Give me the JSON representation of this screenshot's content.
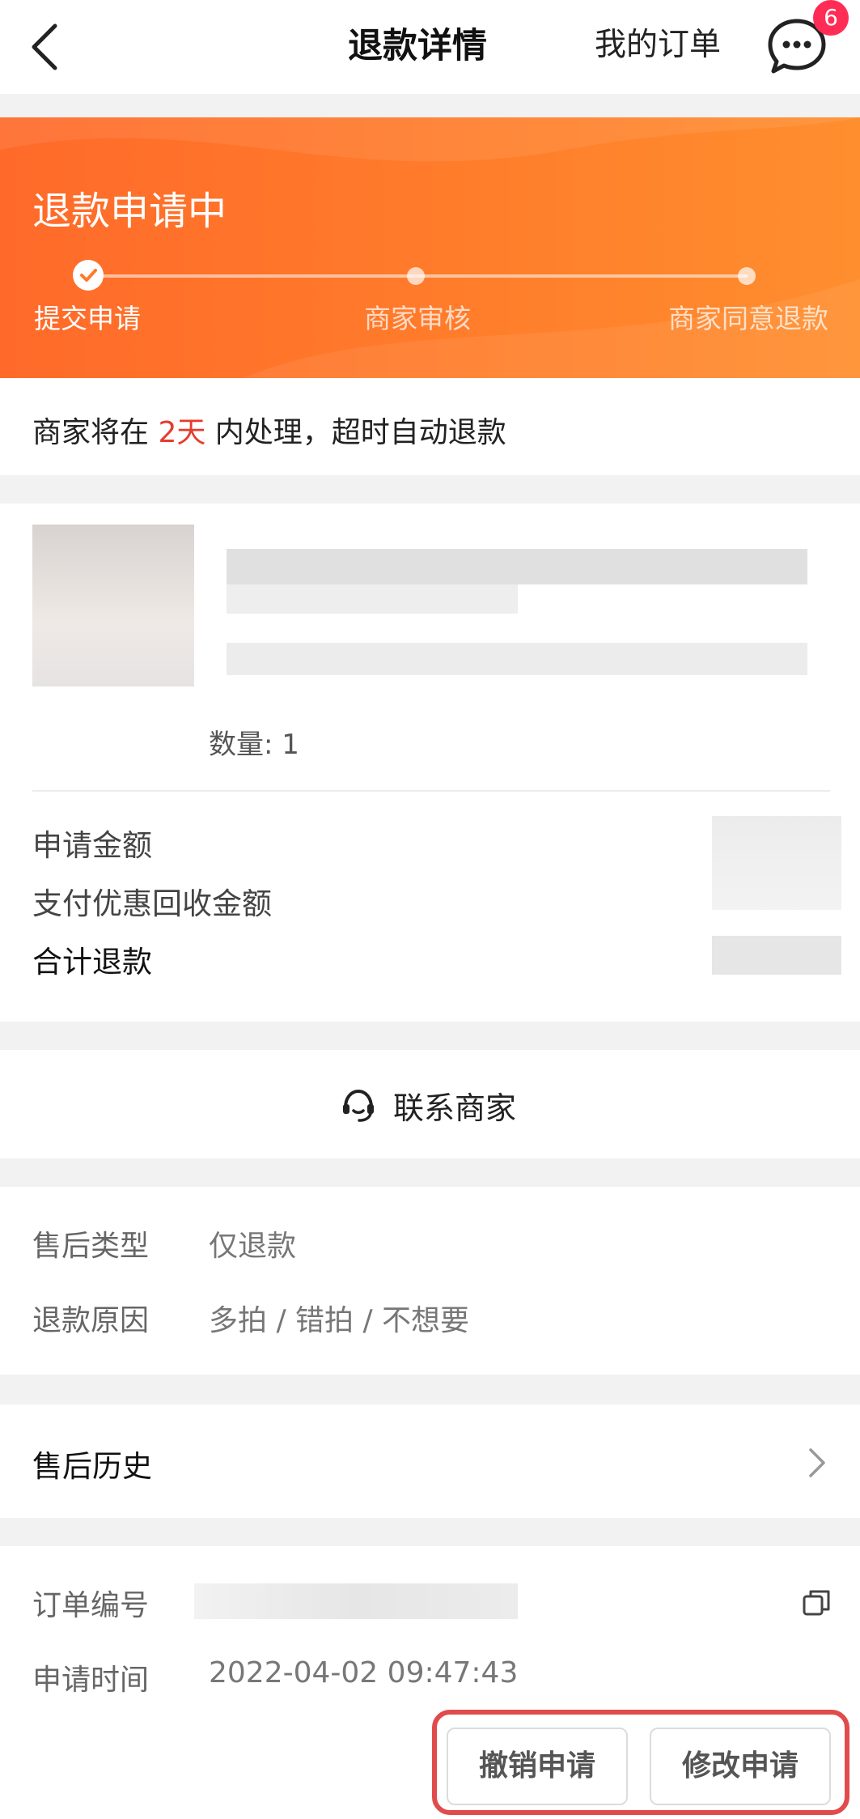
{
  "header": {
    "title": "退款详情",
    "orders_link": "我的订单",
    "message_badge": "6"
  },
  "status": {
    "title": "退款申请中",
    "steps": [
      {
        "label": "提交申请",
        "done": true
      },
      {
        "label": "商家审核",
        "done": false
      },
      {
        "label": "商家同意退款",
        "done": false
      }
    ]
  },
  "notice": {
    "prefix": "商家将在 ",
    "days": "2天",
    "suffix": " 内处理，超时自动退款"
  },
  "product": {
    "quantity": "数量: 1"
  },
  "amounts": {
    "apply_label": "申请金额",
    "discount_label": "支付优惠回收金额",
    "total_label": "合计退款"
  },
  "contact": {
    "label": "联系商家"
  },
  "info": {
    "type_key": "售后类型",
    "type_val": "仅退款",
    "reason_key": "退款原因",
    "reason_val": "多拍 / 错拍 / 不想要"
  },
  "history": {
    "label": "售后历史"
  },
  "order": {
    "number_key": "订单编号",
    "time_key": "申请时间",
    "time_val": "2022-04-02 09:47:43"
  },
  "actions": {
    "cancel": "撤销申请",
    "modify": "修改申请"
  },
  "colors": {
    "accent": "#ff7a2b",
    "highlight": "#e63b2e",
    "badge": "#ff2d55"
  }
}
